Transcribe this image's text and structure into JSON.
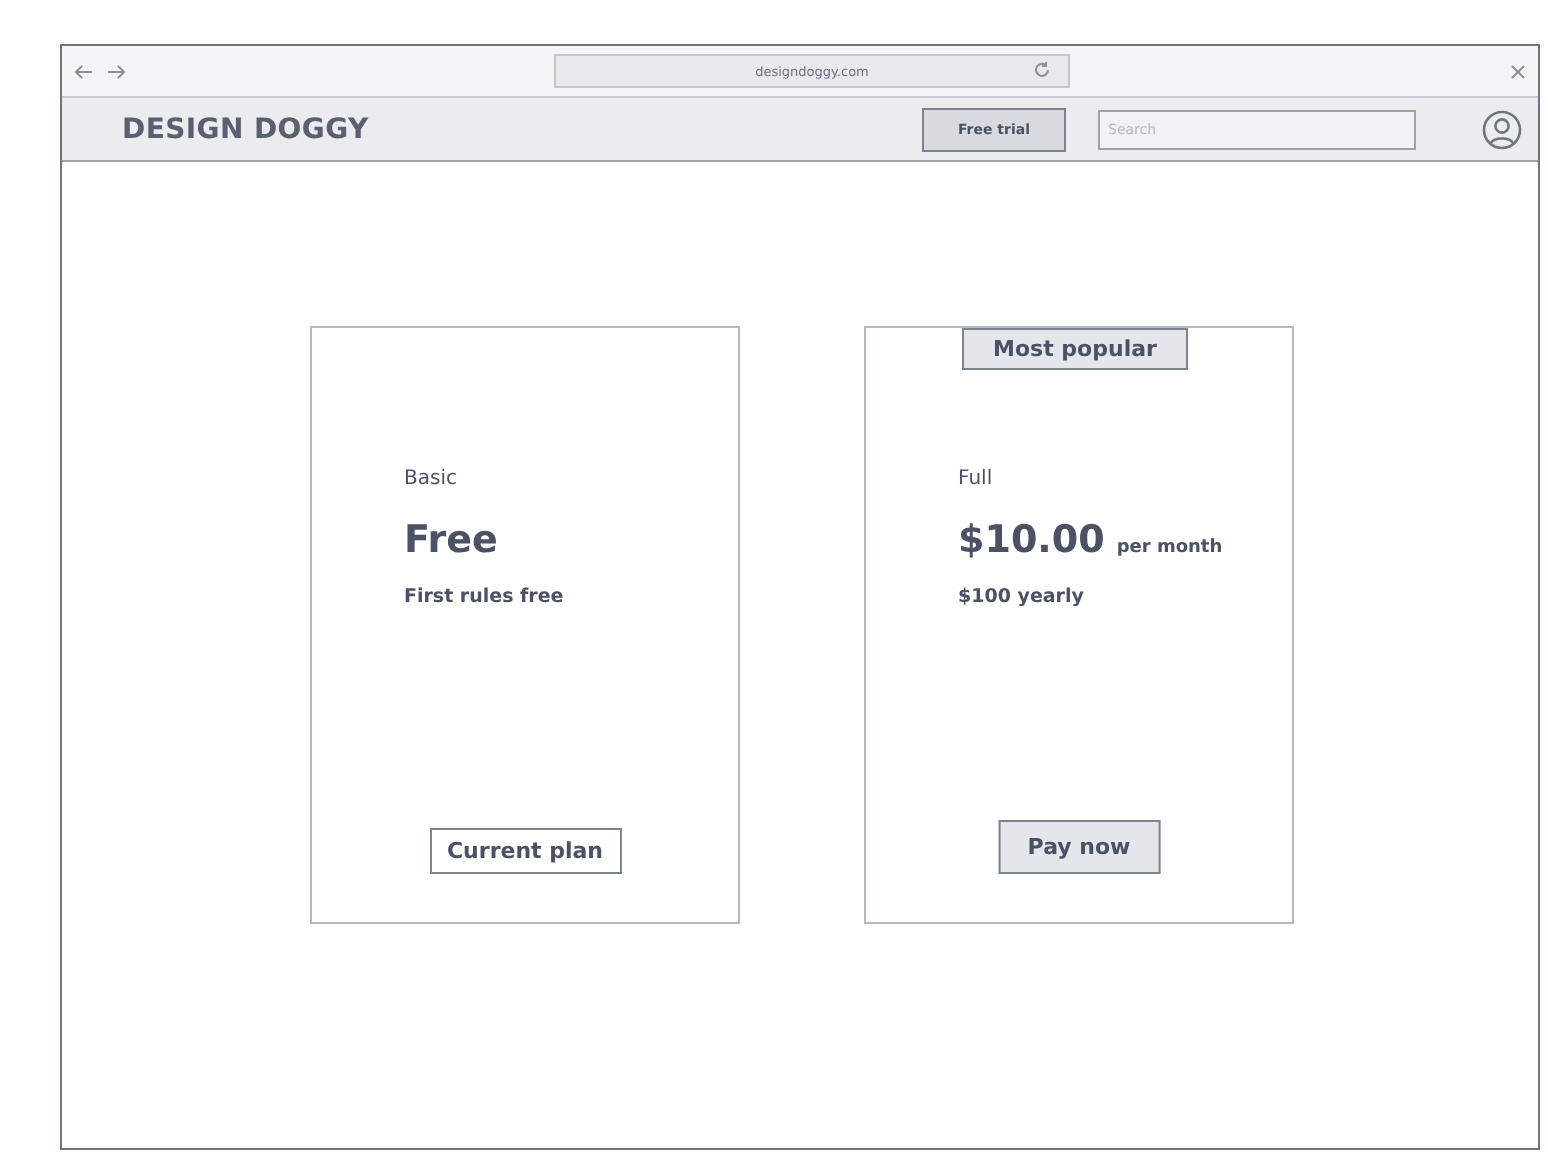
{
  "browser": {
    "url": "designdoggy.com"
  },
  "nav": {
    "logo": "DESIGN DOGGY",
    "cta": "Free trial",
    "search": {
      "placeholder": "Search"
    }
  },
  "plans": [
    {
      "kind": "current",
      "name": "Basic",
      "price": "Free",
      "note": "First rules free",
      "button": "Current plan"
    },
    {
      "kind": "upgrade",
      "badge": "Most popular",
      "name": "Full",
      "price": "$10.00",
      "period": "per month",
      "note": "$100 yearly",
      "button": "Pay now"
    }
  ]
}
